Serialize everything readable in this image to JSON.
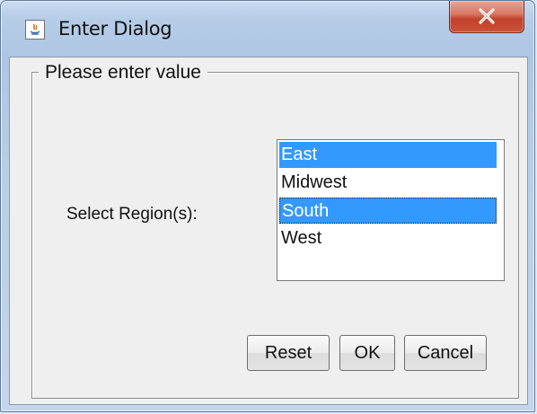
{
  "window": {
    "title": "Enter Dialog",
    "close_glyph": "✕"
  },
  "group": {
    "legend": "Please enter value"
  },
  "form": {
    "region_label": "Select Region(s):",
    "regions": [
      {
        "label": "East",
        "selected": true
      },
      {
        "label": "Midwest",
        "selected": false
      },
      {
        "label": "South",
        "selected": true,
        "focused": true
      },
      {
        "label": "West",
        "selected": false
      }
    ]
  },
  "buttons": {
    "reset": "Reset",
    "ok": "OK",
    "cancel": "Cancel"
  },
  "colors": {
    "selection": "#3399ff",
    "close_button": "#c9533b"
  }
}
